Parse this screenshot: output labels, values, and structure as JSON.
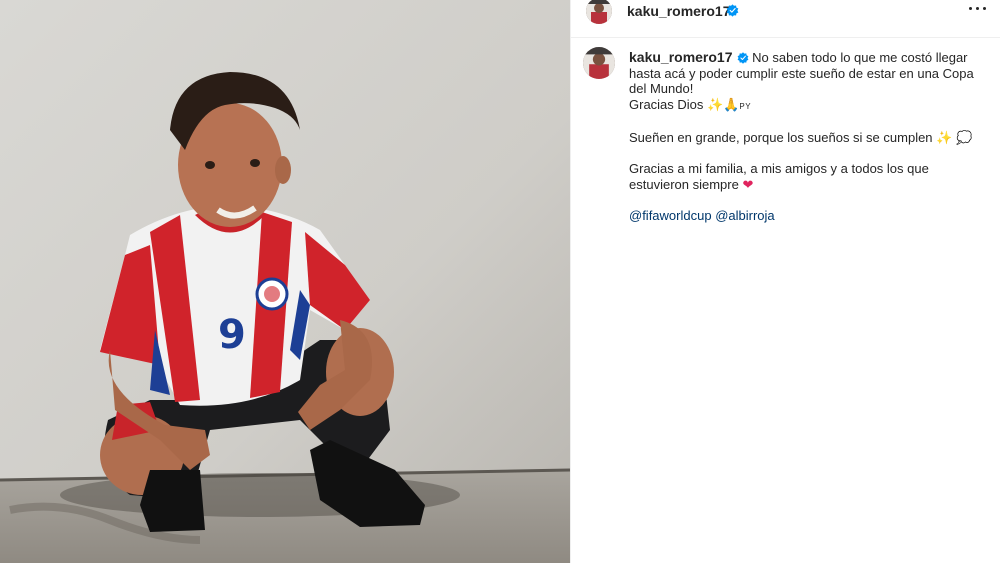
{
  "post": {
    "username": "kaku_romero17",
    "verified": true,
    "caption": {
      "line1": "No saben todo lo que me costó llegar hasta acá y poder cumplir este sueño de estar en una Copa del Mundo!",
      "line2": "Gracias Dios",
      "line2_emoji": "✨🙏",
      "line2_flag": "PY",
      "line3": "Sueñen en grande, porque los sueños si se cumplen",
      "line3_emoji": "✨ 💭",
      "line4": "Gracias a mi familia, a mis amigos y a todos los que estuvieron siempre",
      "line4_emoji": "❤",
      "mention1": "@fifaworldcup",
      "mention2": "@albirroja"
    },
    "photo": {
      "jersey_number": "9"
    }
  },
  "colors": {
    "verified_blue": "#0095f6",
    "mention_blue": "#00376b",
    "text": "#262626",
    "jersey_red": "#d0232b",
    "jersey_blue": "#1d3f95"
  },
  "icons": {
    "more": "more-options-icon",
    "verified": "verified-badge-icon"
  }
}
